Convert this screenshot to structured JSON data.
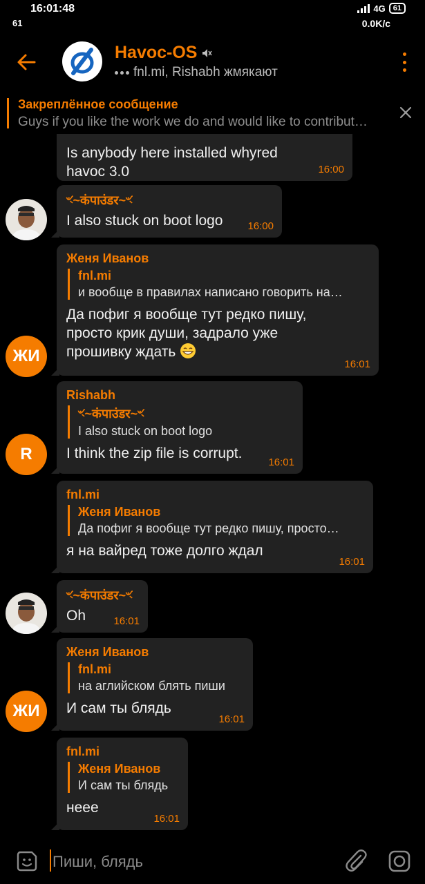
{
  "status_bar": {
    "time": "16:01:48",
    "notif_count": "61",
    "network": "4G",
    "battery": "61",
    "speed": "0.0K/c"
  },
  "header": {
    "title": "Havoc-OS",
    "status": "fnl.mi, Rishabh жмякают"
  },
  "pinned": {
    "title": "Закреплённое сообщение",
    "text": "Guys if you like the work we do and would like to contribut…"
  },
  "messages": [
    {
      "text": "Is anybody here installed whyred havoc 3.0",
      "time": "16:00"
    },
    {
      "sender": "ৼ~कंपाउंडर~ৼ",
      "text": "I also stuck on boot logo",
      "time": "16:00"
    },
    {
      "sender": "Женя Иванов",
      "reply_name": "fnl.mi",
      "reply_text": "и вообще в правилах написано говорить на…",
      "text": "Да пофиг я вообще тут редко пишу, просто крик души, задрало уже прошивку ждать",
      "time": "16:01",
      "avatar": "ЖИ"
    },
    {
      "sender": "Rishabh",
      "reply_name": "ৼ~कंपाउंडर~ৼ",
      "reply_text": "I also stuck on boot logo",
      "text": "I think the zip file is corrupt.",
      "time": "16:01",
      "avatar": "R"
    },
    {
      "sender": "fnl.mi",
      "reply_name": "Женя Иванов",
      "reply_text": "Да пофиг я вообще тут редко пишу, просто…",
      "text": "я на вайред тоже долго ждал",
      "time": "16:01"
    },
    {
      "sender": "ৼ~कंपाउंडर~ৼ",
      "text": "Oh",
      "time": "16:01"
    },
    {
      "sender": "Женя Иванов",
      "reply_name": "fnl.mi",
      "reply_text": "на аглийском блять пиши",
      "text": "И сам ты блядь",
      "time": "16:01",
      "avatar": "ЖИ"
    },
    {
      "sender": "fnl.mi",
      "reply_name": "Женя Иванов",
      "reply_text": "И сам ты блядь",
      "text": "нeee",
      "time": "16:01"
    }
  ],
  "input": {
    "placeholder": "Пиши, блядь"
  },
  "colors": {
    "accent": "#f57c00",
    "bubble": "#222222",
    "background": "#000000"
  },
  "icons": [
    "back-arrow-icon",
    "havoc-logo-icon",
    "muted-icon",
    "more-vert-icon",
    "close-icon",
    "sticker-icon",
    "attach-icon",
    "camera-icon",
    "grin-emoji-icon"
  ]
}
